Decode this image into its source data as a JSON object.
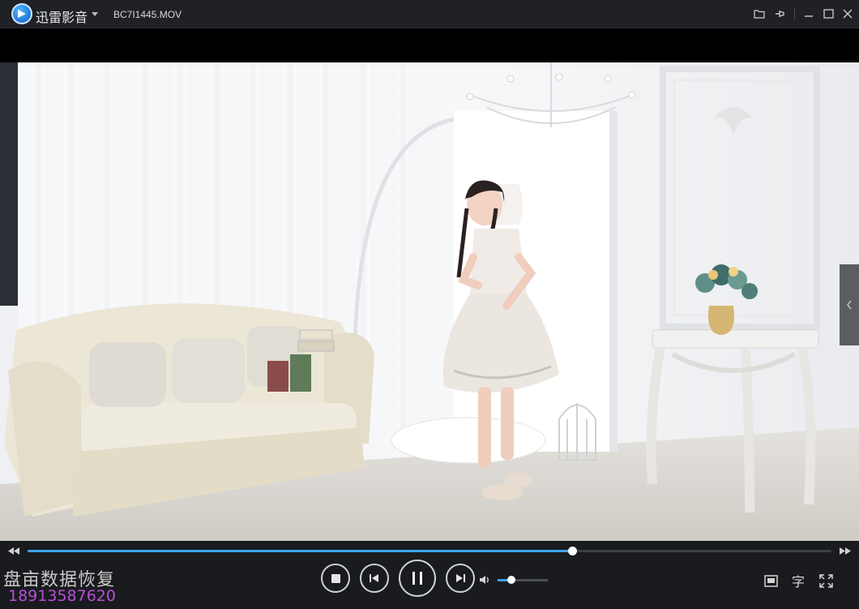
{
  "titlebar": {
    "app_name": "迅雷影音",
    "file_name": "BC7I1445.MOV",
    "icons": [
      "folder-icon",
      "pin-icon",
      "minimize-icon",
      "maximize-icon",
      "close-icon"
    ]
  },
  "player": {
    "progress": 0.677,
    "volume": 0.28,
    "subtitle_label": "字"
  },
  "watermark": {
    "line1": "盘亩数据恢复",
    "line2": "18913587620"
  },
  "colors": {
    "accent": "#3ba3f5",
    "titlebar_bg": "#1f2124",
    "controls_bg": "#191b1e",
    "watermark_phone": "#b84ed8"
  }
}
